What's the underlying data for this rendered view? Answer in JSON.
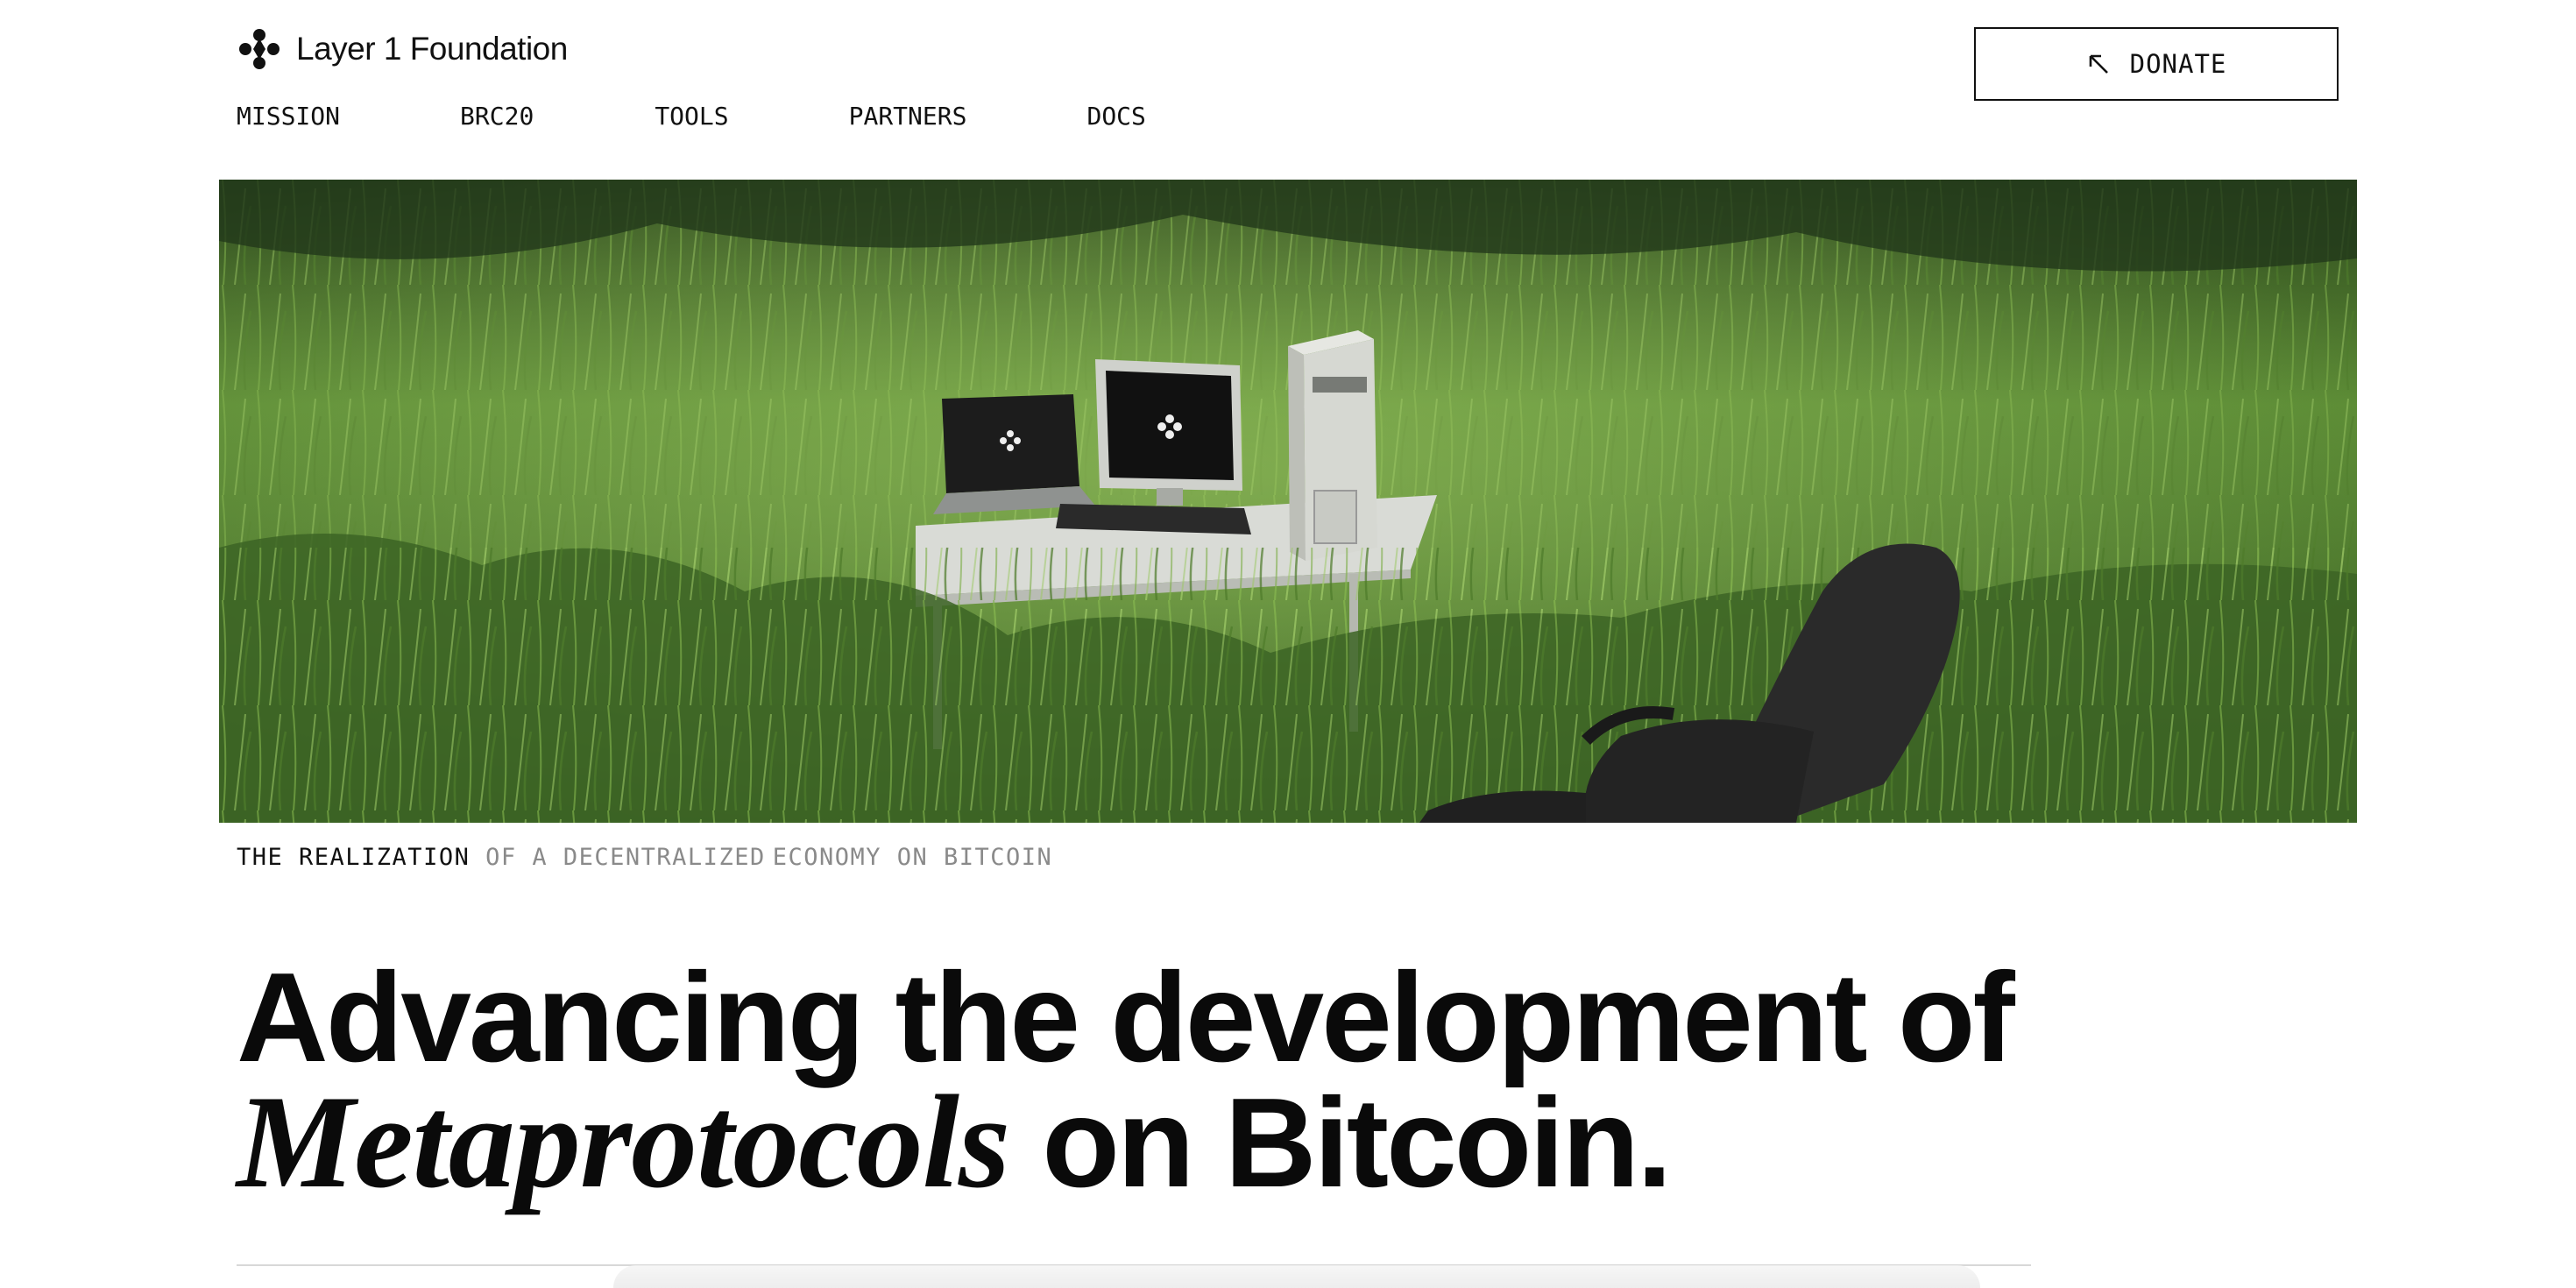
{
  "brand": {
    "name": "Layer 1 Foundation",
    "logo_icon": "fleur-logo-icon"
  },
  "nav": {
    "items": [
      {
        "label": "MISSION"
      },
      {
        "label": "BRC20"
      },
      {
        "label": "TOOLS"
      },
      {
        "label": "PARTNERS"
      },
      {
        "label": "DOCS"
      }
    ]
  },
  "donate": {
    "label": "DONATE",
    "icon": "arrow-up-left-icon"
  },
  "tagline": {
    "strong": "THE REALIZATION",
    "muted1": "OF A DECENTRALIZED",
    "muted2": "ECONOMY ON BITCOIN"
  },
  "headline": {
    "line1": "Advancing the development of",
    "italic": "Metaprotocols",
    "rest": " on Bitcoin."
  },
  "colors": {
    "text": "#000000",
    "muted": "#8a8a8a",
    "background": "#ffffff",
    "grass": "#4a7a2c"
  }
}
